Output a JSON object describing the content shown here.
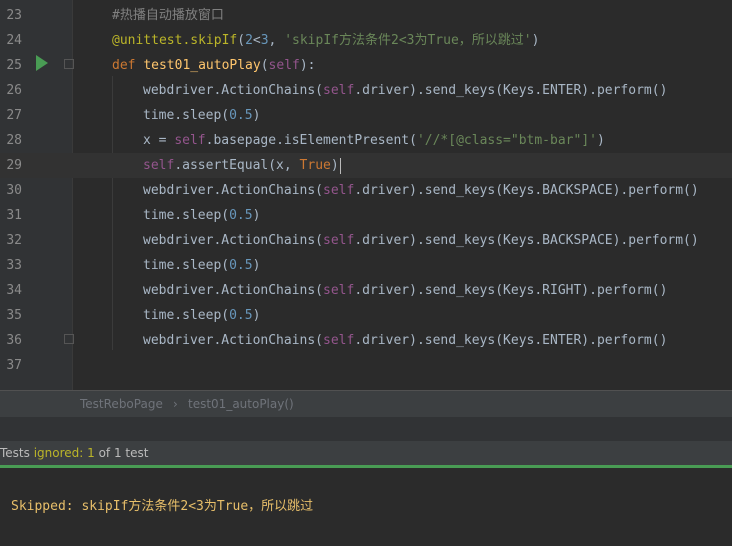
{
  "editor": {
    "lines": [
      {
        "n": "23",
        "parts": [
          {
            "c": "comment",
            "t": "#热播自动播放窗口"
          }
        ]
      },
      {
        "n": "24",
        "parts": [
          {
            "c": "deco",
            "t": "@unittest.skipIf"
          },
          {
            "c": "",
            "t": "("
          },
          {
            "c": "num",
            "t": "2"
          },
          {
            "c": "",
            "t": "<"
          },
          {
            "c": "num",
            "t": "3"
          },
          {
            "c": "",
            "t": ", "
          },
          {
            "c": "str",
            "t": "'skipIf方法条件2<3为True，所以跳过'"
          },
          {
            "c": "",
            "t": ")"
          }
        ]
      },
      {
        "n": "25",
        "parts": [
          {
            "c": "kw",
            "t": "def "
          },
          {
            "c": "fn",
            "t": "test01_autoPlay"
          },
          {
            "c": "",
            "t": "("
          },
          {
            "c": "self",
            "t": "self"
          },
          {
            "c": "",
            "t": "):"
          }
        ]
      },
      {
        "n": "26",
        "parts": [
          {
            "c": "",
            "t": "webdriver.ActionChains("
          },
          {
            "c": "self",
            "t": "self"
          },
          {
            "c": "",
            "t": ".driver).send_keys(Keys.ENTER).perform()"
          }
        ]
      },
      {
        "n": "27",
        "parts": [
          {
            "c": "",
            "t": "time.sleep("
          },
          {
            "c": "num",
            "t": "0.5"
          },
          {
            "c": "",
            "t": ")"
          }
        ]
      },
      {
        "n": "28",
        "parts": [
          {
            "c": "",
            "t": "x = "
          },
          {
            "c": "self",
            "t": "self"
          },
          {
            "c": "",
            "t": ".basepage.isElementPresent("
          },
          {
            "c": "str",
            "t": "'//*[@class=\"btm-bar\"]'"
          },
          {
            "c": "",
            "t": ")"
          }
        ]
      },
      {
        "n": "29",
        "parts": [
          {
            "c": "self",
            "t": "self"
          },
          {
            "c": "",
            "t": ".assertEqual(x, "
          },
          {
            "c": "const",
            "t": "True"
          },
          {
            "c": "",
            "t": ")"
          }
        ]
      },
      {
        "n": "30",
        "parts": [
          {
            "c": "",
            "t": "webdriver.ActionChains("
          },
          {
            "c": "self",
            "t": "self"
          },
          {
            "c": "",
            "t": ".driver).send_keys(Keys.BACKSPACE).perform()"
          }
        ]
      },
      {
        "n": "31",
        "parts": [
          {
            "c": "",
            "t": "time.sleep("
          },
          {
            "c": "num",
            "t": "0.5"
          },
          {
            "c": "",
            "t": ")"
          }
        ]
      },
      {
        "n": "32",
        "parts": [
          {
            "c": "",
            "t": "webdriver.ActionChains("
          },
          {
            "c": "self",
            "t": "self"
          },
          {
            "c": "",
            "t": ".driver).send_keys(Keys.BACKSPACE).perform()"
          }
        ]
      },
      {
        "n": "33",
        "parts": [
          {
            "c": "",
            "t": "time.sleep("
          },
          {
            "c": "num",
            "t": "0.5"
          },
          {
            "c": "",
            "t": ")"
          }
        ]
      },
      {
        "n": "34",
        "parts": [
          {
            "c": "",
            "t": "webdriver.ActionChains("
          },
          {
            "c": "self",
            "t": "self"
          },
          {
            "c": "",
            "t": ".driver).send_keys(Keys.RIGHT).perform()"
          }
        ]
      },
      {
        "n": "35",
        "parts": [
          {
            "c": "",
            "t": "time.sleep("
          },
          {
            "c": "num",
            "t": "0.5"
          },
          {
            "c": "",
            "t": ")"
          }
        ]
      },
      {
        "n": "36",
        "parts": [
          {
            "c": "",
            "t": "webdriver.ActionChains("
          },
          {
            "c": "self",
            "t": "self"
          },
          {
            "c": "",
            "t": ".driver).send_keys(Keys.ENTER).perform()"
          }
        ]
      },
      {
        "n": "37",
        "parts": []
      }
    ],
    "current_line": "29"
  },
  "breadcrumb": {
    "class_name": "TestReboPage",
    "separator": "›",
    "method_name": "test01_autoPlay()"
  },
  "test_status": {
    "prefix": "Tests ",
    "ignored_label": "ignored: 1",
    "suffix": " of 1 test"
  },
  "console": {
    "output": "Skipped: skipIf方法条件2<3为True，所以跳过"
  },
  "colors": {
    "background": "#2b2b2b",
    "run_icon": "#499c54",
    "console_text": "#e8bf6a",
    "ignored": "#bbb529"
  }
}
